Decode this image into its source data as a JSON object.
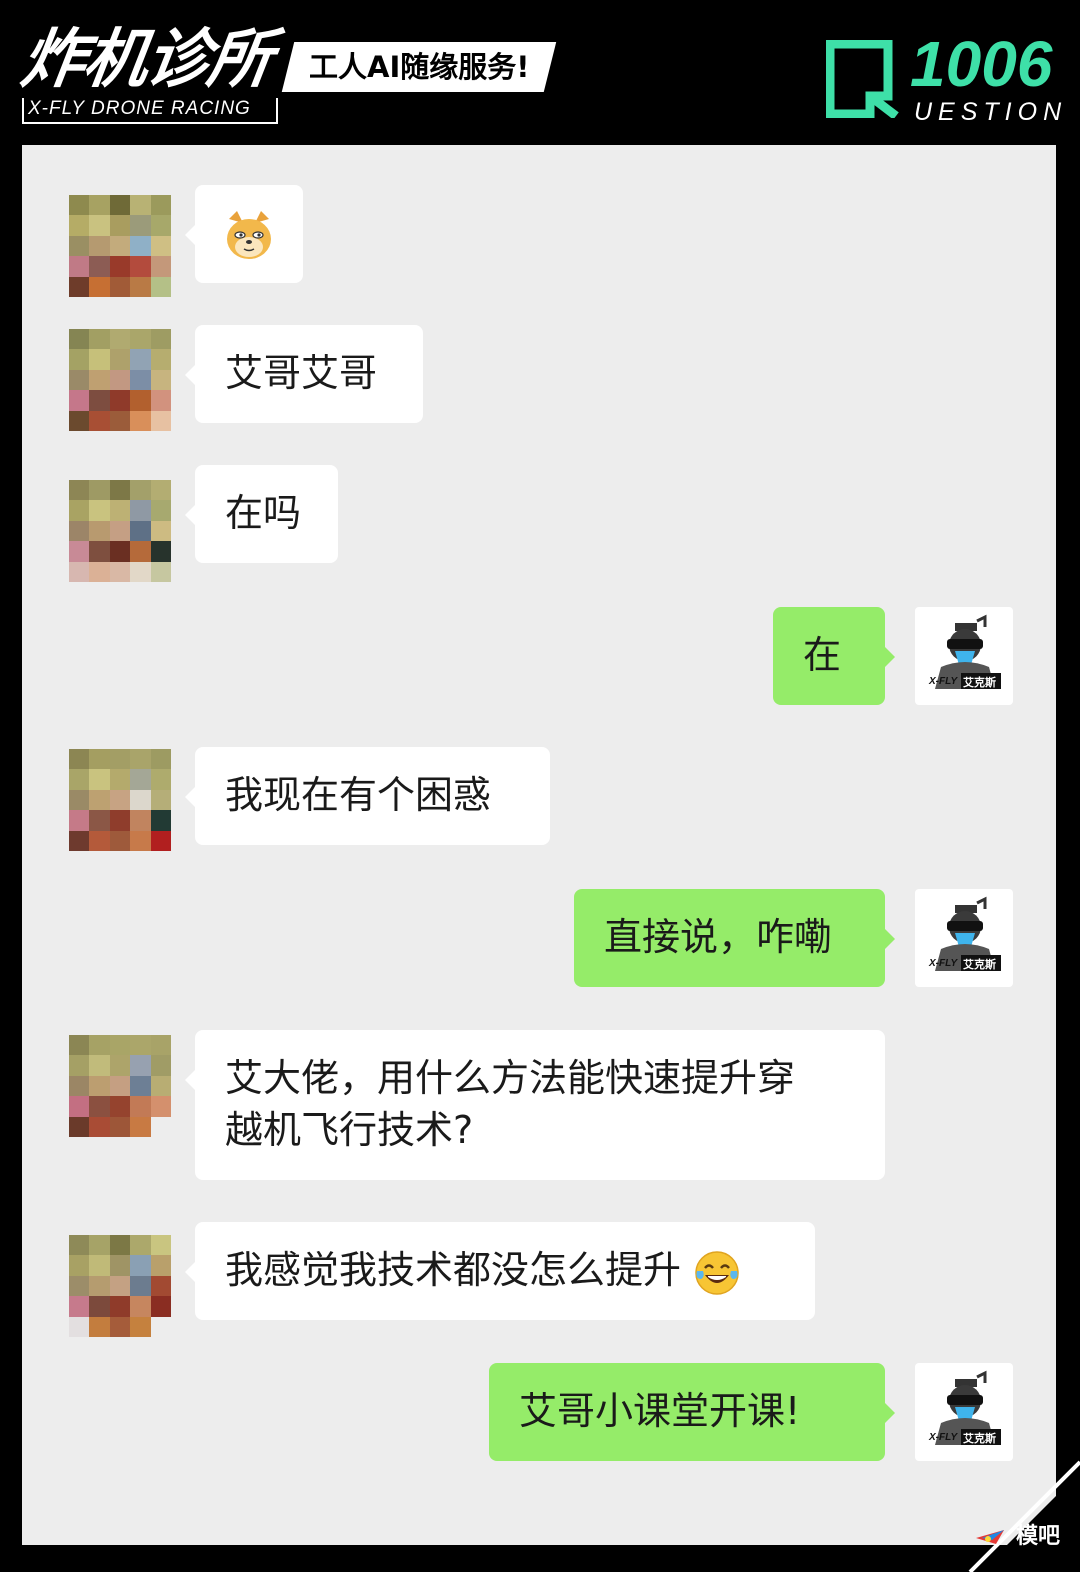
{
  "header": {
    "brand_title": "炸机诊所",
    "brand_sub": "X-FLY DRONE RACING",
    "slogan": "工人AI随缘服务!",
    "q_number": "1006",
    "q_word": "UESTION"
  },
  "messages": [
    {
      "side": "left",
      "text": "",
      "emoji": "doge-emoji"
    },
    {
      "side": "left",
      "text": "艾哥艾哥"
    },
    {
      "side": "left",
      "text": "在吗"
    },
    {
      "side": "right",
      "text": "在"
    },
    {
      "side": "left",
      "text": "我现在有个困惑"
    },
    {
      "side": "right",
      "text": "直接说，咋嘞"
    },
    {
      "side": "left",
      "text_line1": "艾大佬，用什么方法能快速提升穿",
      "text_line2": "越机飞行技术?"
    },
    {
      "side": "left",
      "text": "我感觉我技术都没怎么提升",
      "emoji": "tears-of-joy-emoji"
    },
    {
      "side": "right",
      "text": "艾哥小课堂开课!"
    }
  ],
  "my_avatar_label": "X-FLY 艾克斯",
  "watermark": "模吧",
  "colors": {
    "accent_green": "#3ee0a8",
    "my_bubble": "#95ec69",
    "panel": "#ededed"
  }
}
